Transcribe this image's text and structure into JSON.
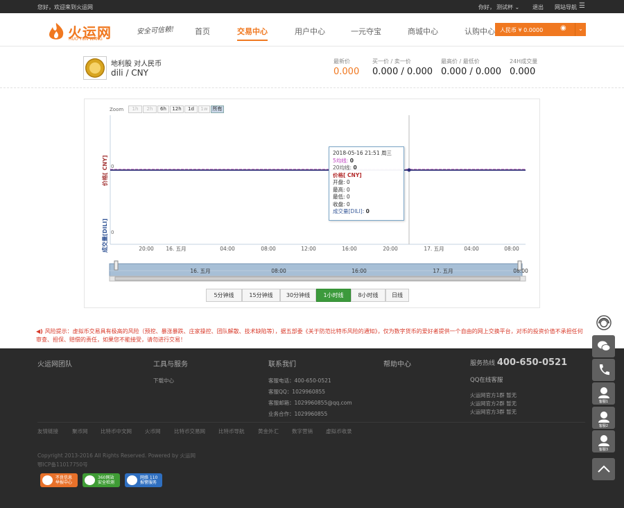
{
  "topbar": {
    "welcome": "您好，欢迎来到火运网",
    "greeting": "你好，",
    "user": "测试杯",
    "logout": "退出",
    "sitenav": "网站导航"
  },
  "brand": {
    "name": "火运网",
    "sub": "HUO·YUN·WANG",
    "slogan": "安全可信赖!"
  },
  "nav": {
    "items": [
      "首页",
      "交易中心",
      "用户中心",
      "一元夺宝",
      "商城中心",
      "认购中心"
    ],
    "active": 1
  },
  "balance": {
    "label": "人民币 ¥ 0.0000"
  },
  "pair": {
    "name": "地利股 对人民币",
    "base": "dili",
    "sep": " / ",
    "quote": "CNY"
  },
  "stats": [
    {
      "label": "最新价",
      "value": "0.000"
    },
    {
      "label": "买一价 / 卖一价",
      "value": "0.000 / 0.000"
    },
    {
      "label": "最高价 / 最低价",
      "value": "0.000 / 0.000"
    },
    {
      "label": "24H成交量",
      "value": "0.000"
    }
  ],
  "zoom": {
    "label": "Zoom",
    "buttons": [
      "1h",
      "2h",
      "6h",
      "12h",
      "1d",
      "1w",
      "所有"
    ],
    "disabled": [
      0,
      1,
      5
    ],
    "selected": 6
  },
  "chart_data": {
    "type": "line",
    "title": "",
    "price_axis_label": "价格[ CNY]",
    "volume_axis_label": "成交量[DILI]",
    "price_tick": "0",
    "volume_tick": "0",
    "x_ticks": [
      "20:00",
      "16. 五月",
      "04:00",
      "08:00",
      "12:00",
      "16:00",
      "20:00",
      "17. 五月",
      "04:00",
      "08:00"
    ],
    "navigator_ticks": [
      "16. 五月",
      "08:00",
      "16:00",
      "17. 五月",
      "08:00"
    ],
    "series": [
      {
        "name": "5均线",
        "values": [
          0,
          0,
          0,
          0,
          0,
          0,
          0,
          0,
          0,
          0
        ]
      },
      {
        "name": "20均线",
        "values": [
          0,
          0,
          0,
          0,
          0,
          0,
          0,
          0,
          0,
          0
        ]
      },
      {
        "name": "价格",
        "values": [
          0,
          0,
          0,
          0,
          0,
          0,
          0,
          0,
          0,
          0
        ]
      },
      {
        "name": "成交量",
        "values": [
          0,
          0,
          0,
          0,
          0,
          0,
          0,
          0,
          0,
          0
        ]
      }
    ],
    "ylim": [
      0,
      1
    ],
    "grid": false
  },
  "tooltip": {
    "date": "2018-05-16 21:51 周三",
    "ma5_label": "5均线:",
    "ma5": "0",
    "ma20_label": "20均线:",
    "ma20": "0",
    "price_title": "价格[ CNY]",
    "open_label": "开盘:",
    "open": "0",
    "high_label": "最高:",
    "high": "0",
    "low_label": "最低:",
    "low": "0",
    "close_label": "收盘:",
    "close": "0",
    "vol_label": "成交量[DILI]:",
    "vol": "0"
  },
  "timeframes": {
    "buttons": [
      "5分钟线",
      "15分钟线",
      "30分钟线",
      "1小时线",
      "8小时线",
      "日线"
    ],
    "selected": 3
  },
  "risk": {
    "text": "风险提示：虚拟币交易具有极高的风险（预挖、暴涨暴跌、庄家操控、团队解散、技术缺陷等），据五部委《关于防范比特币风险的通知》，仅为数字货币的爱好者提供一个自由的网上交换平台，对币的投资价值不承担任何审查、担保、赔偿的责任，如果您不能接受，请勿进行交易！"
  },
  "footer": {
    "col1": {
      "title": "火运网团队"
    },
    "col2": {
      "title": "工具与服务",
      "items": [
        "下载中心"
      ]
    },
    "col3": {
      "title": "联系我们",
      "items": [
        "客服电话：400-650-0521",
        "客服QQ：1029960855",
        "客服邮箱：1029960855@qq.com",
        "业务合作：1029960855"
      ]
    },
    "col4": {
      "title": "帮助中心"
    },
    "col5": {
      "hotline_label": "服务热线",
      "hotline": "400-650-0521",
      "qq_service": "QQ在线客服",
      "groups": [
        "火运网官方1群 暂无",
        "火运网官方2群 暂无",
        "火运网官方3群 暂无"
      ]
    },
    "links": [
      "友情链接",
      "聚币网",
      "比特币中文网",
      "火币网",
      "比特币交易网",
      "比特币导航",
      "黄金外汇",
      "数字营销",
      "虚拟币收录"
    ],
    "copyright": "Copyright 2013-2016 All Rights Reserved. Powered by 火运网",
    "icp": "鄂ICP备11017750号",
    "badges": [
      {
        "title": "不良信息",
        "sub": "举报中心",
        "color": "#e8712a"
      },
      {
        "title": "360网站",
        "sub": "安全检测",
        "color": "#3f9c35"
      },
      {
        "title": "网络 110",
        "sub": "报警服务",
        "color": "#2f6fc0"
      }
    ]
  },
  "sidebar": {
    "items": [
      "",
      "",
      "",
      "客服1",
      "客服2",
      "客服3",
      ""
    ]
  }
}
